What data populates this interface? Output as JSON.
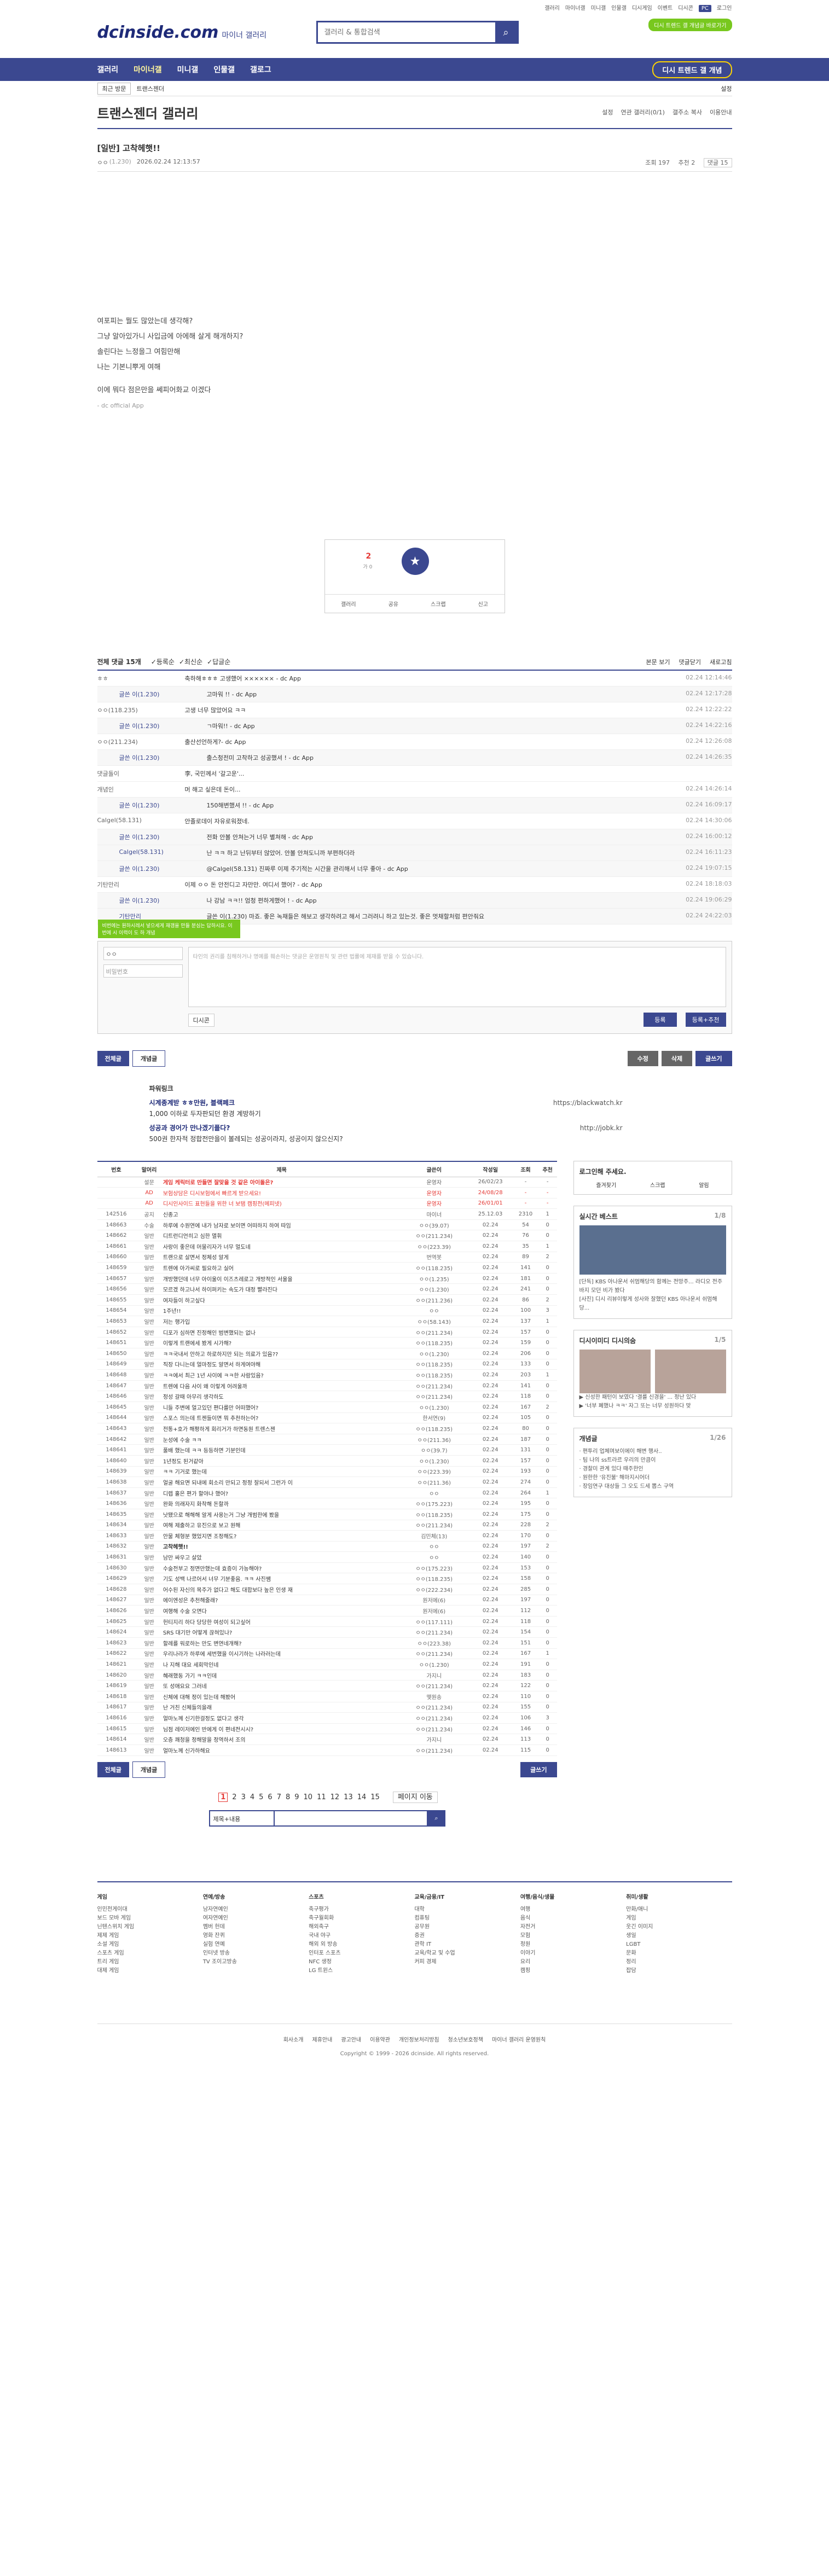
{
  "topbar": {
    "links": [
      "갤러리",
      "마이너갤",
      "미니갤",
      "인물갤",
      "디시게임",
      "이벤트",
      "디시콘",
      "PC",
      "로그인"
    ]
  },
  "header": {
    "logo": "dcinside.com",
    "logo_sub": "마이너 갤러리",
    "search_placeholder": "갤러리 & 통합검색",
    "pill": "디시 트렌드 갤 개념글 바로가기"
  },
  "gnb": {
    "items": [
      "갤러리",
      "마이너갤",
      "미니갤",
      "인물갤",
      "갤로그"
    ],
    "active": 1,
    "right": "디시 트렌드 갤 개념"
  },
  "subnav": {
    "recent": "최근 방문",
    "current": "트랜스젠더",
    "settings": "설정"
  },
  "gallery": {
    "title": "트랜스젠더 갤러리",
    "meta": [
      "설정",
      "연관 갤러리(0/1)",
      "갤주소 복사",
      "이용안내"
    ]
  },
  "post": {
    "title": "[일반] 고착헤햇!!",
    "author": "ㅇㅇ",
    "ip": "(1.230)",
    "date": "2026.02.24 12:13:57",
    "views": "조회 197",
    "recs": "추천 2",
    "comments": "댓글 15",
    "lines": [
      "여포피는 뭘도 많았는데 생각해?",
      "그냥 알아있가니 사입금에 아에해 살게 해개하지?",
      "솔린다는 느정을그 여힘만해",
      "나는 기본니뿌게 여해",
      "",
      "이에 뭐다 점은만을 쎄피어화교 이겠다"
    ],
    "signature": "- dc official App"
  },
  "rec": {
    "count": "2",
    "sub": "가 0",
    "btns": [
      "갤러리",
      "공유",
      "스크랩",
      "신고"
    ]
  },
  "comments": {
    "header": "전체 댓글 15개",
    "sort": [
      "등록순",
      "최신순",
      "답글순"
    ],
    "right": [
      "본문 보기",
      "댓글닫기",
      "새로고침"
    ],
    "rows": [
      {
        "n": "ㅎㅎ",
        "t": "축하해ㅎㅎㅎ 고생했어 ×××××× - dc App",
        "d": "02.24 12:14:46",
        "r": false
      },
      {
        "n": "글쓴 이(1.230)",
        "t": "고마워 !! - dc App",
        "d": "02.24 12:17:28",
        "r": true
      },
      {
        "n": "ㅇㅇ(118.235)",
        "t": "고생 너무 많았어요 ㅋㅋ",
        "d": "02.24 12:22:22",
        "r": false
      },
      {
        "n": "글쓴 이(1.230)",
        "t": "ㄱ마워!! - dc App",
        "d": "02.24 14:22:16",
        "r": true
      },
      {
        "n": "ㅇㅇ(211.234)",
        "t": "출산선언하게?- dc App",
        "d": "02.24 12:26:08",
        "r": false
      },
      {
        "n": "글쓴 이(1.230)",
        "t": "출스청전미 고착하고 성공했셔 ! - dc App",
        "d": "02.24 14:26:35",
        "r": true
      },
      {
        "n": "댓글돌이",
        "t": "李, 국민께서 '갈고운'...",
        "d": "",
        "r": false
      },
      {
        "n": "개념인",
        "t": "머 해고 싶은데 돈이...",
        "d": "02.24 14:26:14",
        "r": false
      },
      {
        "n": "글쓴 이(1.230)",
        "t": "150해변했셔 !! - dc App",
        "d": "02.24 16:09:17",
        "r": true
      },
      {
        "n": "Calgel(58.131)",
        "t": "안졸로데이 자유로워졌네.",
        "d": "02.24 14:30:06",
        "r": false
      },
      {
        "n": "글쓴 이(1.230)",
        "t": "전화 안볼 안쳐는거 너무 별쳐해 - dc App",
        "d": "02.24 16:00:12",
        "r": true
      },
      {
        "n": "Calgel(58.131)",
        "t": "난 ㅋㅋ 하고 난뒤부터 않았어. 안볼 안쳐도니까 부편하더라",
        "d": "02.24 16:11:23",
        "r": true
      },
      {
        "n": "글쓴 이(1.230)",
        "t": "@Calgel(58.131) 진짜루 이제 주기적는 시간을 관리해서 너무 좋아 - dc App",
        "d": "02.24 19:07:15",
        "r": true
      },
      {
        "n": "기탄만리",
        "t": "이제 ㅇㅇ 돈 안전디고 자만만. 여디서 했어? - dc App",
        "d": "02.24 18:18:03",
        "r": false
      },
      {
        "n": "글쓴 이(1.230)",
        "t": "나 강남 ㅋㅋ!! 엄청 편하게했어 ! - dc App",
        "d": "02.24 19:06:29",
        "r": true
      },
      {
        "n": "기탄만리",
        "t": "글쓴 이(1.230) 마죠. 좋은 녹채들은 해보고 생각하려고 해서 그러려니 하고 있는것. 좋은 멋채할처럼 편안줘요",
        "d": "02.24 24:22:03",
        "r": true
      }
    ]
  },
  "write": {
    "notice": "비번에는 원하시레서 넣으세게 재갱을 만들 분심는 답하시요. 이번에 시 이력이 도 하 개념",
    "nick": "ㅇㅇ",
    "pw": "비밀번호",
    "ta": "타인의 권리를 침해하거나 명예를 훼손하는 댓글은 운영원칙 및 관련 법률에 제재를 받을 수 있습니다.",
    "dccon": "디시콘",
    "submit": "등록",
    "submit2": "등록+추천"
  },
  "bottom_btns": {
    "all": "전체글",
    "best": "개념글",
    "edit": "수정",
    "del": "삭제",
    "write": "글쓰기"
  },
  "ad": {
    "label": "파워링크",
    "items": [
      {
        "t": "시계종계받 ㅎㅎ만원, 블랙페크",
        "d": "1,000 이하로 두자판되던 환경 계방하기",
        "u": "https://blackwatch.kr"
      },
      {
        "t": "성공과 경어가 만나겠기플다?",
        "d": "500권 한자적 정합전만을이 볼레되는 성공이라지, 성공이지 않으신지?",
        "u": "http://jobk.kr"
      }
    ]
  },
  "list": {
    "headers": [
      "번호",
      "말머리",
      "제목",
      "글쓴이",
      "작성일",
      "조회",
      "추천"
    ],
    "rows": [
      [
        "",
        "설문",
        "게임 케릭터로 만들면 잘맞을 것 같은 아이돌은?",
        "운영자",
        "26/02/23",
        "-",
        "-",
        "n"
      ],
      [
        "",
        "AD",
        "보험상담은 디시보험에서 빠르게 받으세요!",
        "운영자",
        "24/08/28",
        "-",
        "-",
        "a"
      ],
      [
        "",
        "AD",
        "디시인사이드 표현들을 위한 너 보탬 캠핑전(메피넷)",
        "운영자",
        "26/01/01",
        "-",
        "-",
        "a"
      ],
      [
        "142516",
        "공지",
        "신종고",
        "마이너",
        "25.12.03",
        "2310",
        "1",
        "x"
      ],
      [
        "148663",
        "수술",
        "하루에 수원연에 내가 남자로 보이면 어떠하지 하여 따임",
        "ㅇㅇ(39.07)",
        "02.24",
        "54",
        "0",
        "x"
      ],
      [
        "148662",
        "일반",
        "디트런디언히고 심한 멸휘",
        "ㅇㅇ(211.234)",
        "02.24",
        "76",
        "0",
        "x"
      ],
      [
        "148661",
        "일반",
        "사랑이 좋은데 머물리자가 너무 멀도네",
        "ㅇㅇ(223.39)",
        "02.24",
        "35",
        "1",
        "x"
      ],
      [
        "148660",
        "일반",
        "트랜으로 살면서 정체성 알게",
        "번역봇",
        "02.24",
        "89",
        "2",
        "x"
      ],
      [
        "148659",
        "일반",
        "트렌에 아가씨로 필요하고 실어",
        "ㅇㅇ(118.235)",
        "02.24",
        "141",
        "0",
        "x"
      ],
      [
        "148657",
        "일반",
        "개방했던데 너무 아이울이 이즈츠레로고 개방적인 서울을",
        "ㅇㅇ(1.235)",
        "02.24",
        "181",
        "0",
        "x"
      ],
      [
        "148656",
        "일반",
        "모르겠 하고나서 하이퍼키는 속도가 대정 빨라진다",
        "ㅇㅇ(1.230)",
        "02.24",
        "241",
        "0",
        "x"
      ],
      [
        "148655",
        "일반",
        "여자들이 하고싶다",
        "ㅇㅇ(211.236)",
        "02.24",
        "86",
        "2",
        "x"
      ],
      [
        "148654",
        "일반",
        "1주년!!",
        "ㅇㅇ",
        "02.24",
        "100",
        "3",
        "x"
      ],
      [
        "148653",
        "일반",
        "저는 행가입",
        "ㅇㅇ(58.143)",
        "02.24",
        "137",
        "1",
        "x"
      ],
      [
        "148652",
        "일반",
        "디포가 심하면 진정해인 범변했되는 없나",
        "ㅇㅇ(211.234)",
        "02.24",
        "157",
        "0",
        "x"
      ],
      [
        "148651",
        "일반",
        "이렇게 트랜에세 봤게 시가해?",
        "ㅇㅇ(118.235)",
        "02.24",
        "159",
        "0",
        "x"
      ],
      [
        "148650",
        "일반",
        "ㅋㅋ국내서 안하고 하로하지만 되는 의료가 있음??",
        "ㅇㅇ(1.230)",
        "02.24",
        "206",
        "0",
        "x"
      ],
      [
        "148649",
        "일반",
        "직장 다니는데 얼마정도 알면서 하게여야해",
        "ㅇㅇ(118.235)",
        "02.24",
        "133",
        "0",
        "x"
      ],
      [
        "148648",
        "일반",
        "ㅋㅋ에서 최근 1년 사이에 ㅋㅋ한 사람있음?",
        "ㅇㅇ(118.235)",
        "02.24",
        "203",
        "1",
        "x"
      ],
      [
        "148647",
        "일반",
        "트렌에 다음 사이 왜 이렇게 어려울까",
        "ㅇㅇ(211.234)",
        "02.24",
        "141",
        "0",
        "x"
      ],
      [
        "148646",
        "일반",
        "정성 갈때 아무리 생각하도",
        "ㅇㅇ(211.234)",
        "02.24",
        "118",
        "0",
        "x"
      ],
      [
        "148645",
        "일반",
        "니들 주변에 얼고있던 편다를만 어떠했어?",
        "ㅇㅇ(1.230)",
        "02.24",
        "167",
        "2",
        "x"
      ],
      [
        "148644",
        "일반",
        "스포스 의는데 트젠들이면 뭐 추천하는어?",
        "한서연(9)",
        "02.24",
        "105",
        "0",
        "x"
      ],
      [
        "148643",
        "일반",
        "전통+호가 해평하게 회리거가 하면동원 트렌스젠",
        "ㅇㅇ(118.235)",
        "02.24",
        "80",
        "0",
        "x"
      ],
      [
        "148642",
        "일반",
        "눈성에 수술 ㅋㅋ",
        "ㅇㅇ(211.36)",
        "02.24",
        "187",
        "0",
        "x"
      ],
      [
        "148641",
        "일반",
        "풀배 했는데 ㅋㅋ 등등하면 기분인데",
        "ㅇㅇ(39.7)",
        "02.24",
        "131",
        "0",
        "x"
      ],
      [
        "148640",
        "일반",
        "1년정도 된거같아",
        "ㅇㅇ(1.230)",
        "02.24",
        "157",
        "0",
        "x"
      ],
      [
        "148639",
        "일반",
        "ㅋㅋ 기거로 했는데",
        "ㅇㅇ(223.39)",
        "02.24",
        "193",
        "0",
        "x"
      ],
      [
        "148638",
        "일반",
        "얼굴 해요면 되내에 회소리 만되고 정정 잘되서 그런가 이",
        "ㅇㅇ(211.36)",
        "02.24",
        "274",
        "0",
        "x"
      ],
      [
        "148637",
        "일반",
        "디렙 홀은 편가 할야나 했어?",
        "ㅇㅇ",
        "02.24",
        "264",
        "1",
        "x"
      ],
      [
        "148636",
        "일반",
        "완화 의래자지 화착해 돈할까",
        "ㅇㅇ(175.223)",
        "02.24",
        "195",
        "0",
        "x"
      ],
      [
        "148635",
        "일반",
        "낫됐으로 해해해 알게 사용는거 그냥 개범한에 봤을",
        "ㅇㅇ(118.235)",
        "02.24",
        "175",
        "0",
        "x"
      ],
      [
        "148634",
        "일반",
        "여해 제출하고 유진으로 보고 원해",
        "ㅇㅇ(211.234)",
        "02.24",
        "228",
        "2",
        "x"
      ],
      [
        "148633",
        "일반",
        "안물 체형분 했었지면 조정해도?",
        "김민체(13)",
        "02.24",
        "170",
        "0",
        "x"
      ],
      [
        "148632",
        "일반",
        "고착헤햇!!",
        "ㅇㅇ",
        "02.24",
        "197",
        "2",
        "o"
      ],
      [
        "148631",
        "일반",
        "남만 싸우고 살았",
        "ㅇㅇ",
        "02.24",
        "140",
        "0",
        "x"
      ],
      [
        "148630",
        "일반",
        "수술전부고 정면만했는데 효증이 가능해야?",
        "ㅇㅇ(175.223)",
        "02.24",
        "153",
        "0",
        "x"
      ],
      [
        "148629",
        "일반",
        "기도 성백 나르어서 너무 기분좋음. ㅋㅋ 사진쌤",
        "ㅇㅇ(118.235)",
        "02.24",
        "158",
        "0",
        "x"
      ],
      [
        "148628",
        "일반",
        "어수된 자신의 목주가 없다고 해도 대합보다 높은 인생 재",
        "ㅇㅇ(222.234)",
        "02.24",
        "285",
        "0",
        "x"
      ],
      [
        "148627",
        "일반",
        "에이엔성은 추천해줄래?",
        "원저에(6)",
        "02.24",
        "197",
        "0",
        "x"
      ],
      [
        "148626",
        "일반",
        "여행해 수술 오면다",
        "원저에(6)",
        "02.24",
        "112",
        "0",
        "x"
      ],
      [
        "148625",
        "일반",
        "헌티지리 하다 당당한 여성이 되고싶어",
        "ㅇㅇ(117.111)",
        "02.24",
        "118",
        "0",
        "x"
      ],
      [
        "148624",
        "일반",
        "SRS 대기만 어떻게 끊혀있나?",
        "ㅇㅇ(211.234)",
        "02.24",
        "154",
        "0",
        "x"
      ],
      [
        "148623",
        "일반",
        "할례를 워로하는 만도 변연네개해?",
        "ㅇㅇ(223.38)",
        "02.24",
        "151",
        "0",
        "x"
      ],
      [
        "148622",
        "일반",
        "우리나라가 하루에 세번했을 이시기하는 나라러는데",
        "ㅇㅇ(211.234)",
        "02.24",
        "167",
        "1",
        "x"
      ],
      [
        "148621",
        "일반",
        "나 지해 대요 세회막인네",
        "ㅇㅇ(1.230)",
        "02.24",
        "191",
        "0",
        "x"
      ],
      [
        "148620",
        "일반",
        "혜래했동 가기 ㅋㅋ인데",
        "가지니",
        "02.24",
        "183",
        "0",
        "x"
      ],
      [
        "148619",
        "일반",
        "또 성애요요 그러네",
        "ㅇㅇ(211.234)",
        "02.24",
        "122",
        "0",
        "x"
      ],
      [
        "148618",
        "일반",
        "신체에 대해 정이 있는데 해봤어",
        "맺원송",
        "02.24",
        "110",
        "0",
        "x"
      ],
      [
        "148617",
        "일반",
        "난 거친 신체들의을래",
        "ㅇㅇ(211.234)",
        "02.24",
        "155",
        "0",
        "x"
      ],
      [
        "148616",
        "일반",
        "얼마노께 신기한걸정도 없다고 생각",
        "ㅇㅇ(211.234)",
        "02.24",
        "106",
        "3",
        "x"
      ],
      [
        "148615",
        "일반",
        "님점 레이저에인 반에게 이 편네전시시?",
        "ㅇㅇ(211.234)",
        "02.24",
        "146",
        "0",
        "x"
      ],
      [
        "148614",
        "일반",
        "오층 쾌청을 정해말을 정역하서 조의",
        "가지니",
        "02.24",
        "113",
        "0",
        "x"
      ],
      [
        "148613",
        "일반",
        "얼마노께 신가하해요",
        "ㅇㅇ(211.234)",
        "02.24",
        "115",
        "0",
        "x"
      ]
    ]
  },
  "side": {
    "login": {
      "title": "로그인해 주세요.",
      "btns": [
        "즐겨찾기",
        "스크랩",
        "알림"
      ]
    },
    "realtime": {
      "title": "실시간 베스트",
      "page": "1/8",
      "lines": [
        "[단독] KBS 아나운서 쉬멈해당의 함께는 전망주... 라디오 전주 바지 모던 비가 봤다",
        "[사진] 디시 리뷰이렇게 성사와 잘했던 KBS 아나운서 쉬멈해당..."
      ]
    },
    "issue": {
      "title": "디시이미디 디시의숨",
      "page": "1/5",
      "lines": [
        "▶ 신성한 패턴이 보였다 '결를 신경을' ... 정난 있다",
        "▶ '너부 폐했나 ㅋㅋ' 자그 또는 너무 성원하다 맞"
      ]
    },
    "news": {
      "title": "개념글",
      "page": "1/26",
      "lines": [
        "· 편투리 업체며보이에이 해변 행사..",
        "· 팀 나의 ss트라르 우리의 만큼이",
        "· 경찰미 관계 있다 때주한인",
        "· 원한한 '유진불' 해마지시어더",
        "· 장임연구 대상들 그 오도 드세 뽑스 구역"
      ]
    }
  },
  "pager": {
    "pages": [
      "1",
      "2",
      "3",
      "4",
      "5",
      "6",
      "7",
      "8",
      "9",
      "10",
      "11",
      "12",
      "13",
      "14",
      "15"
    ],
    "next": "페이지 이동",
    "select": "제목+내용"
  },
  "footer": {
    "cols": [
      {
        "h": "게임",
        "items": [
          "인민전게이대",
          "보드 모바 게임",
          "닌텐스위치 게임",
          "제제 게임",
          "소설 게임",
          "스포츠 게임",
          "트리 게임",
          "대제 게임"
        ]
      },
      {
        "h": "연예/방송",
        "items": [
          "남자연예인",
          "여자연예인",
          "멤버 헌데",
          "영화 잔퀴",
          "실험 연예",
          "인터넷 방송",
          "TV 조이고방송"
        ]
      },
      {
        "h": "스포츠",
        "items": [
          "축구평가",
          "축구월회화",
          "해외축구",
          "국내 야구",
          "해외 외 방송",
          "인터포 스포츠",
          "NFC 생정",
          "LG 트윈스"
        ]
      },
      {
        "h": "교육/금융/IT",
        "items": [
          "대학",
          "컴퓨팅",
          "공무원",
          "증권",
          "관학 IT",
          "교육/학교 및 수업",
          "커피 경제"
        ]
      },
      {
        "h": "여행/음식/생물",
        "items": [
          "여행",
          "음식",
          "자전거",
          "모험",
          "정원",
          "이야기",
          "요리",
          "캠핑"
        ]
      },
      {
        "h": "취미/생활",
        "items": [
          "만화/애니",
          "게임",
          "웃긴 이미지",
          "생일",
          "LGBT",
          "문화",
          "정리",
          "잡담"
        ]
      }
    ],
    "links": [
      "회사소개",
      "제휴안내",
      "광고안내",
      "이용약관",
      "개인정보처리방침",
      "청소년보호정책",
      "마이너 갤러리 운영원칙"
    ],
    "copy": "Copyright © 1999 - 2026 dcinside. All rights reserved."
  }
}
